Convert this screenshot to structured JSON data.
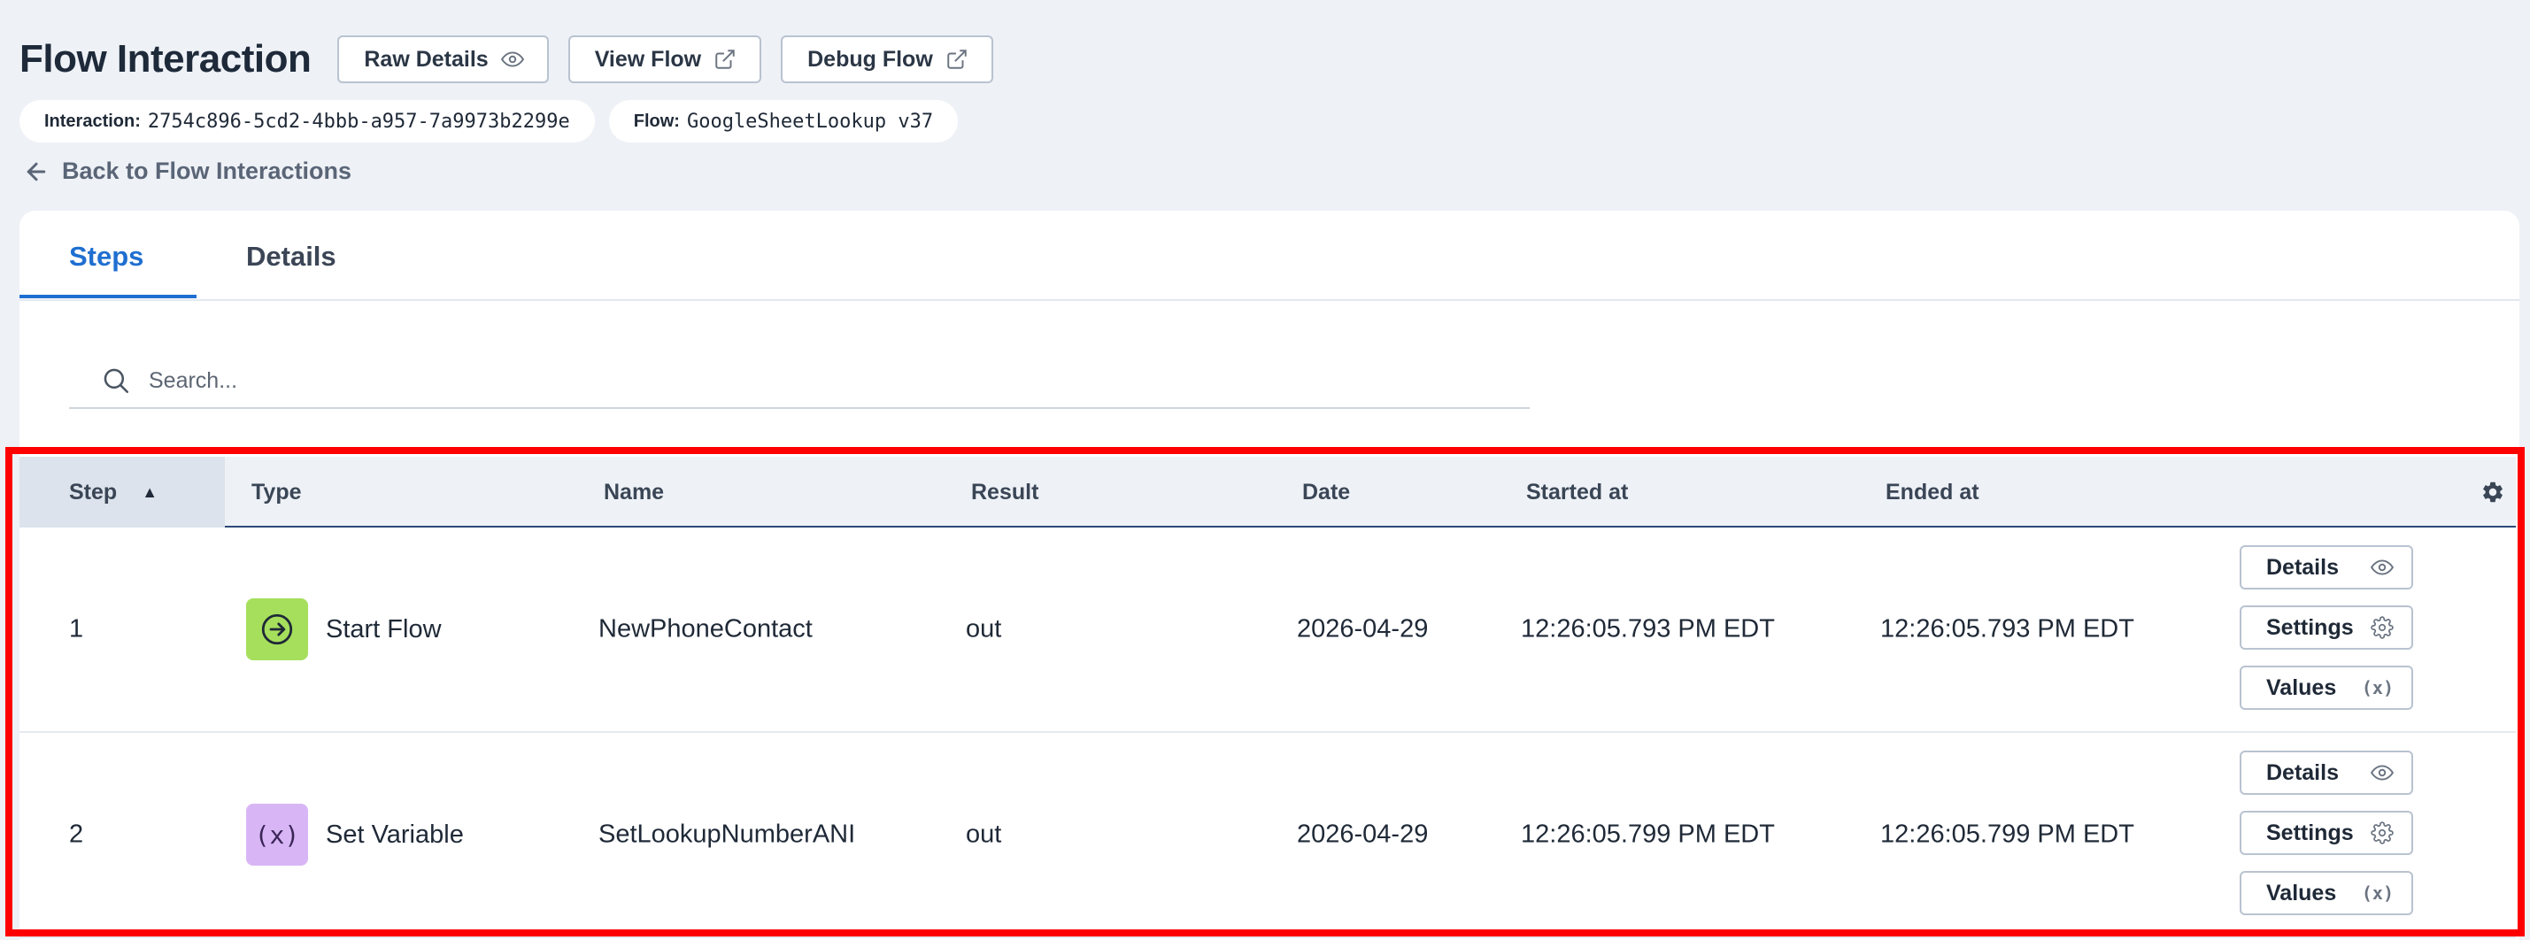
{
  "header": {
    "title": "Flow Interaction",
    "buttons": [
      {
        "label": "Raw Details",
        "icon": "eye-icon"
      },
      {
        "label": "View Flow",
        "icon": "external-link-icon"
      },
      {
        "label": "Debug Flow",
        "icon": "external-link-icon"
      }
    ]
  },
  "meta": {
    "interaction_label": "Interaction:",
    "interaction_value": "2754c896-5cd2-4bbb-a957-7a9973b2299e",
    "flow_label": "Flow:",
    "flow_value": "GoogleSheetLookup v37"
  },
  "back_link": "Back to Flow Interactions",
  "tabs": [
    {
      "label": "Steps",
      "active": true
    },
    {
      "label": "Details",
      "active": false
    }
  ],
  "search": {
    "placeholder": "Search..."
  },
  "table": {
    "columns": [
      "Step",
      "Type",
      "Name",
      "Result",
      "Date",
      "Started at",
      "Ended at"
    ],
    "sort_column": "Step",
    "sort_direction": "ascending",
    "rows": [
      {
        "step": "1",
        "type": "Start Flow",
        "type_icon": "arrow-circle-icon",
        "type_color": "#a6df5c",
        "name": "NewPhoneContact",
        "result": "out",
        "date": "2026-04-29",
        "started_at": "12:26:05.793 PM EDT",
        "ended_at": "12:26:05.793 PM EDT",
        "actions": [
          "Details",
          "Settings",
          "Values"
        ]
      },
      {
        "step": "2",
        "type": "Set Variable",
        "type_icon": "variable-icon",
        "type_color": "#d8b6f5",
        "name": "SetLookupNumberANI",
        "result": "out",
        "date": "2026-04-29",
        "started_at": "12:26:05.799 PM EDT",
        "ended_at": "12:26:05.799 PM EDT",
        "actions": [
          "Details",
          "Settings",
          "Values"
        ]
      }
    ]
  },
  "colors": {
    "accent": "#1f6fd0",
    "highlight": "#ff0000",
    "background": "#eef1f6"
  }
}
